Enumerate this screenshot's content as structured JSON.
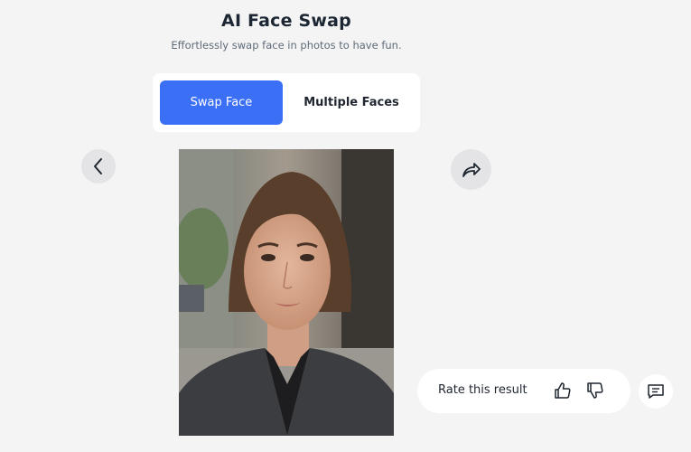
{
  "header": {
    "title": "AI Face Swap",
    "subtitle": "Effortlessly swap face in photos to have fun."
  },
  "tabs": [
    {
      "label": "Swap Face",
      "active": true
    },
    {
      "label": "Multiple Faces",
      "active": false
    }
  ],
  "icons": {
    "back": "chevron-left-icon",
    "share": "share-arrow-icon",
    "thumbs_up": "thumbs-up-icon",
    "thumbs_down": "thumbs-down-icon",
    "feedback": "message-icon"
  },
  "rating": {
    "label": "Rate this result"
  },
  "colors": {
    "background": "#f4f4f5",
    "accent": "#3b6ff5",
    "button_gray": "#e4e4e6",
    "text_dark": "#1f2630"
  }
}
